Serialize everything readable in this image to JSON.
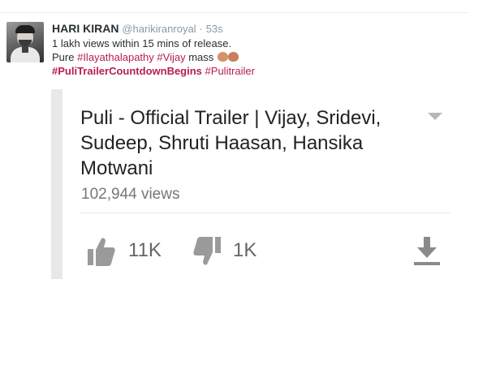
{
  "tweet": {
    "author_name": "HARI KIRAN",
    "author_handle": "@harikiranroyal",
    "separator": "·",
    "time": "53s",
    "line1": "1 lakh views within 15 mins of release.",
    "line2_prefix": "Pure",
    "hashtag_ilayathalapathy": "#Ilayathalapathy",
    "hashtag_vijay": "#Vijay",
    "line2_suffix": "mass",
    "emoji": "clapping-hands",
    "hashtag_countdown": "#PuliTrailerCountdownBegins",
    "hashtag_pulitrailer": "#Pulitrailer"
  },
  "video_card": {
    "title": "Puli - Official Trailer | Vijay, Sridevi, Sudeep, Shruti Haasan, Hansika Motwani",
    "views": "102,944 views",
    "likes": "11K",
    "dislikes": "1K",
    "icons": {
      "like": "thumbs-up-icon",
      "dislike": "thumbs-down-icon",
      "download": "download-icon",
      "menu": "chevron-down-icon"
    }
  },
  "colors": {
    "hashtag": "#b6204d",
    "meta_text": "#8899a6",
    "youtube_icon_gray": "#9a9a9a"
  }
}
